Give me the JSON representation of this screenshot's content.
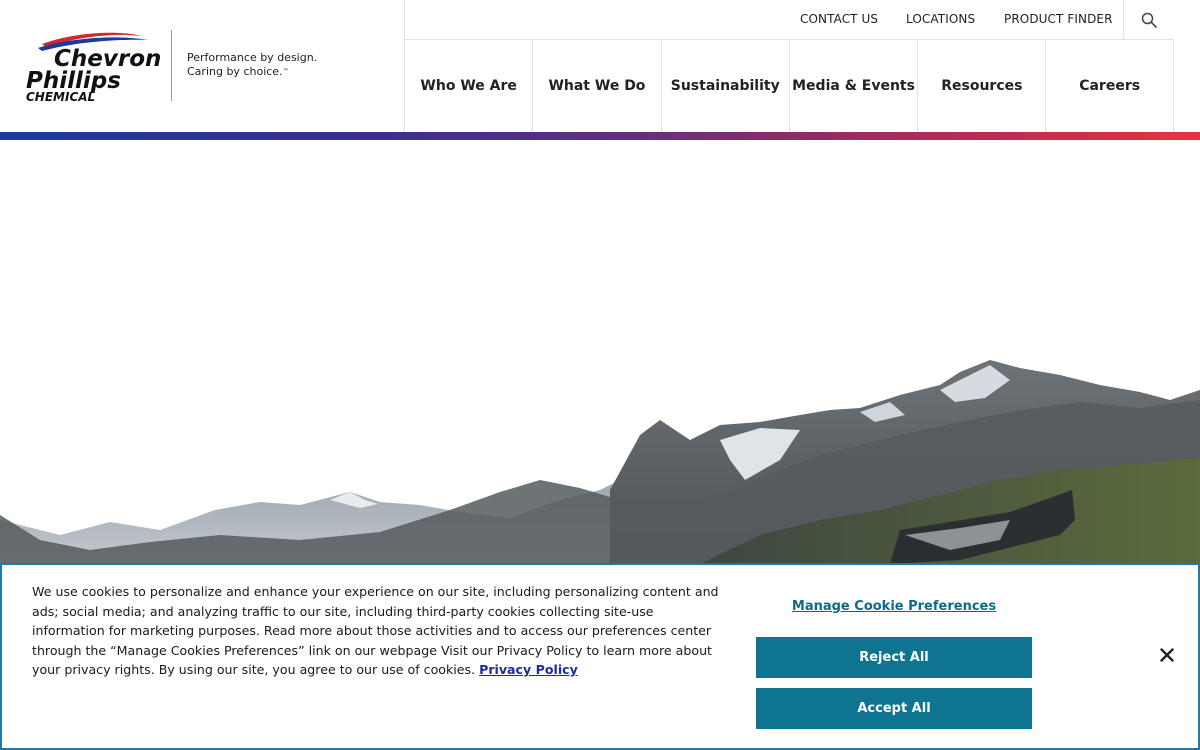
{
  "brand": {
    "logo_line1": "Chevron",
    "logo_line2": "Phillips",
    "logo_line3": "CHEMICAL",
    "tagline_line1": "Performance by design.",
    "tagline_line2": "Caring by choice.",
    "trademark": "™",
    "colors": {
      "swoosh_red": "#d7262f",
      "swoosh_blue": "#1c3a9a"
    }
  },
  "utility_nav": {
    "contact": "CONTACT US",
    "locations": "LOCATIONS",
    "product_finder": "PRODUCT FINDER",
    "search_icon": "search-icon"
  },
  "main_nav": {
    "items": [
      {
        "label": "Who We Are"
      },
      {
        "label": "What We Do"
      },
      {
        "label": "Sustainability"
      },
      {
        "label": "Media & Events"
      },
      {
        "label": "Resources"
      },
      {
        "label": "Careers"
      }
    ]
  },
  "accent_gradient": [
    "#1c3a9a",
    "#e8333c"
  ],
  "cookie_banner": {
    "text": "We use cookies to personalize and enhance your experience on our site, including personalizing content and ads; social media; and analyzing traffic to our site, including third-party cookies collecting site-use information for marketing purposes. Read more about those activities and to access our preferences center through the “Manage Cookies Preferences” link on our webpage Visit our Privacy Policy to learn more about your privacy rights. By using our site, you agree to our use of cookies.",
    "privacy_link": "Privacy Policy",
    "manage_link": "Manage Cookie Preferences",
    "reject": "Reject All",
    "accept": "Accept All",
    "close_icon": "close-icon",
    "button_color": "#0e7490"
  }
}
